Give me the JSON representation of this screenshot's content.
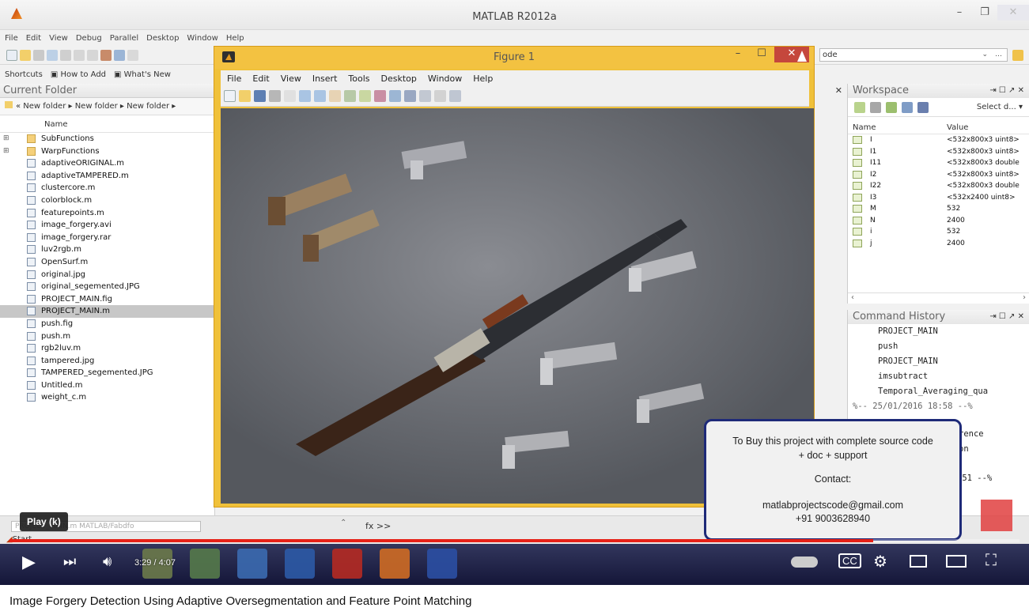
{
  "app": {
    "title": "MATLAB  R2012a",
    "menu": [
      "File",
      "Edit",
      "View",
      "Debug",
      "Parallel",
      "Desktop",
      "Window",
      "Help"
    ],
    "shortcuts": [
      "Shortcuts",
      "How to Add",
      "What's New"
    ],
    "current_dir_value": "ode"
  },
  "current_folder": {
    "title": "Current Folder",
    "breadcrumb": "« New folder ▸ New folder ▸ New folder ▸",
    "column": "Name",
    "files": [
      {
        "name": "SubFunctions",
        "type": "folder"
      },
      {
        "name": "WarpFunctions",
        "type": "folder"
      },
      {
        "name": "adaptiveORIGINAL.m",
        "type": "m"
      },
      {
        "name": "adaptiveTAMPERED.m",
        "type": "m"
      },
      {
        "name": "clustercore.m",
        "type": "m"
      },
      {
        "name": "colorblock.m",
        "type": "m"
      },
      {
        "name": "featurepoints.m",
        "type": "m"
      },
      {
        "name": "image_forgery.avi",
        "type": "avi"
      },
      {
        "name": "image_forgery.rar",
        "type": "rar"
      },
      {
        "name": "luv2rgb.m",
        "type": "m"
      },
      {
        "name": "OpenSurf.m",
        "type": "m"
      },
      {
        "name": "original.jpg",
        "type": "jpg"
      },
      {
        "name": "original_segemented.JPG",
        "type": "jpg"
      },
      {
        "name": "PROJECT_MAIN.fig",
        "type": "fig"
      },
      {
        "name": "PROJECT_MAIN.m",
        "type": "m",
        "selected": true
      },
      {
        "name": "push.fig",
        "type": "fig"
      },
      {
        "name": "push.m",
        "type": "m"
      },
      {
        "name": "rgb2luv.m",
        "type": "m"
      },
      {
        "name": "tampered.jpg",
        "type": "jpg"
      },
      {
        "name": "TAMPERED_segemented.JPG",
        "type": "jpg"
      },
      {
        "name": "Untitled.m",
        "type": "m"
      },
      {
        "name": "weight_c.m",
        "type": "m"
      }
    ]
  },
  "workspace": {
    "title": "Workspace",
    "select_label": "Select d...",
    "col_name": "Name",
    "col_value": "Value",
    "vars": [
      {
        "name": "I",
        "value": "<532x800x3 uint8>"
      },
      {
        "name": "I1",
        "value": "<532x800x3 uint8>"
      },
      {
        "name": "I11",
        "value": "<532x800x3 double"
      },
      {
        "name": "I2",
        "value": "<532x800x3 uint8>"
      },
      {
        "name": "I22",
        "value": "<532x800x3 double"
      },
      {
        "name": "I3",
        "value": "<532x2400 uint8>"
      },
      {
        "name": "M",
        "value": "532"
      },
      {
        "name": "N",
        "value": "2400"
      },
      {
        "name": "i",
        "value": "532"
      },
      {
        "name": "j",
        "value": "2400"
      }
    ]
  },
  "command_history": {
    "title": "Command History",
    "lines": [
      "PROJECT_MAIN",
      "push",
      "PROJECT_MAIN",
      "imsubtract",
      "Temporal_Averaging_qua"
    ],
    "separator": "%-- 25/01/2016 18:58 --%",
    "partial": [
      "rence",
      "on",
      ":51 --%"
    ]
  },
  "command_window": {
    "path_text": "PROJECT_MAIN.m  MATLAB/Fabdfo",
    "prompt": "fx >>"
  },
  "start_label": "Start",
  "figure": {
    "title": "Figure 1",
    "menu": [
      "File",
      "Edit",
      "View",
      "Insert",
      "Tools",
      "Desktop",
      "Window",
      "Help"
    ]
  },
  "promo": {
    "line1": "To Buy this project with complete source code",
    "line2": "+ doc + support",
    "line3": "Contact:",
    "line4": "matlabprojectscode@gmail.com",
    "line5": "+91 9003628940"
  },
  "player": {
    "tooltip": "Play (k)",
    "time": "3:29 / 4:07",
    "progress_fraction": 0.855,
    "caption": "Image Forgery Detection Using Adaptive Oversegmentation and Feature Point Matching"
  },
  "colors": {
    "figure_frame": "#f0c13a",
    "close_red": "#c5473c",
    "progress_red": "#e62117",
    "promo_border": "#1e2a78"
  }
}
